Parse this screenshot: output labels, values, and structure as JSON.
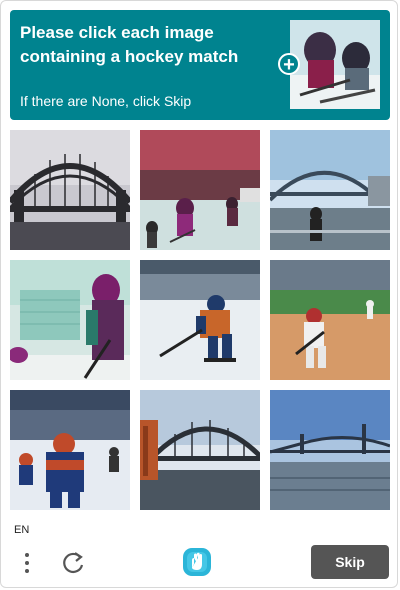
{
  "colors": {
    "accent": "#00838f"
  },
  "header": {
    "prompt": "Please click each image containing a hockey match",
    "subtext": "If there are None, click Skip",
    "example_plus": "+"
  },
  "grid": {
    "tiles": [
      {
        "subject": "bridge",
        "icon": "bridge-image"
      },
      {
        "subject": "hockey",
        "icon": "hockey-image"
      },
      {
        "subject": "bridge",
        "icon": "bridge-image"
      },
      {
        "subject": "hockey",
        "icon": "hockey-image"
      },
      {
        "subject": "hockey",
        "icon": "hockey-image"
      },
      {
        "subject": "baseball",
        "icon": "baseball-image"
      },
      {
        "subject": "hockey",
        "icon": "hockey-image"
      },
      {
        "subject": "bridge",
        "icon": "bridge-image"
      },
      {
        "subject": "bridge",
        "icon": "bridge-image"
      }
    ]
  },
  "footer": {
    "language": "EN",
    "skip_label": "Skip",
    "menu_icon": "more-vertical-icon",
    "refresh_icon": "refresh-icon",
    "logo_icon": "hcaptcha-logo-icon"
  }
}
